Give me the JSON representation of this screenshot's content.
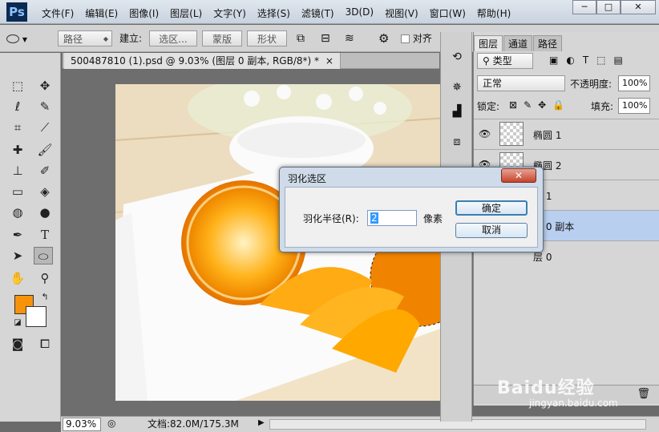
{
  "app": {
    "logo": "Ps"
  },
  "menubar": {
    "items": [
      "文件(F)",
      "编辑(E)",
      "图像(I)",
      "图层(L)",
      "文字(Y)",
      "选择(S)",
      "滤镜(T)",
      "3D(D)",
      "视图(V)",
      "窗口(W)",
      "帮助(H)"
    ]
  },
  "window_buttons": {
    "minimize": "─",
    "maximize": "□",
    "close": "✕"
  },
  "options_bar": {
    "mode_value": "路径",
    "make_label": "建立:",
    "selection_button": "选区...",
    "mask_button": "蒙版",
    "shape_button": "形状",
    "align_label": "对齐"
  },
  "document": {
    "tab_title": "500487810 (1).psd @ 9.03% (图层 0 副本, RGB/8*) *",
    "tab_close": "×"
  },
  "statusbar": {
    "zoom": "9.03%",
    "doc_info": "文档:82.0M/175.3M"
  },
  "colors": {
    "foreground": "#f7930b",
    "background": "#ffffff"
  },
  "layers_panel": {
    "tabs": [
      "图层",
      "通道",
      "路径"
    ],
    "active_tab": "图层",
    "filter_kind": "类型",
    "blend_mode": "正常",
    "opacity_label": "不透明度:",
    "opacity_value": "100%",
    "lock_label": "锁定:",
    "fill_label": "填充:",
    "fill_value": "100%",
    "layers": [
      {
        "name": "椭圆 1",
        "visible": true,
        "selected": false
      },
      {
        "name": "椭圆 2",
        "visible": true,
        "selected": false
      },
      {
        "name": "层 1",
        "visible": false,
        "selected": false
      },
      {
        "name": "层 0 副本",
        "visible": false,
        "selected": true
      },
      {
        "name": "层 0",
        "visible": false,
        "selected": false
      }
    ]
  },
  "dialog": {
    "title": "羽化选区",
    "close": "✕",
    "radius_label": "羽化半径(R):",
    "radius_value": "2",
    "unit": "像素",
    "ok_button": "确定",
    "cancel_button": "取消"
  },
  "watermark": {
    "brand": "Baidu经验",
    "url": "jingyan.baidu.com"
  }
}
